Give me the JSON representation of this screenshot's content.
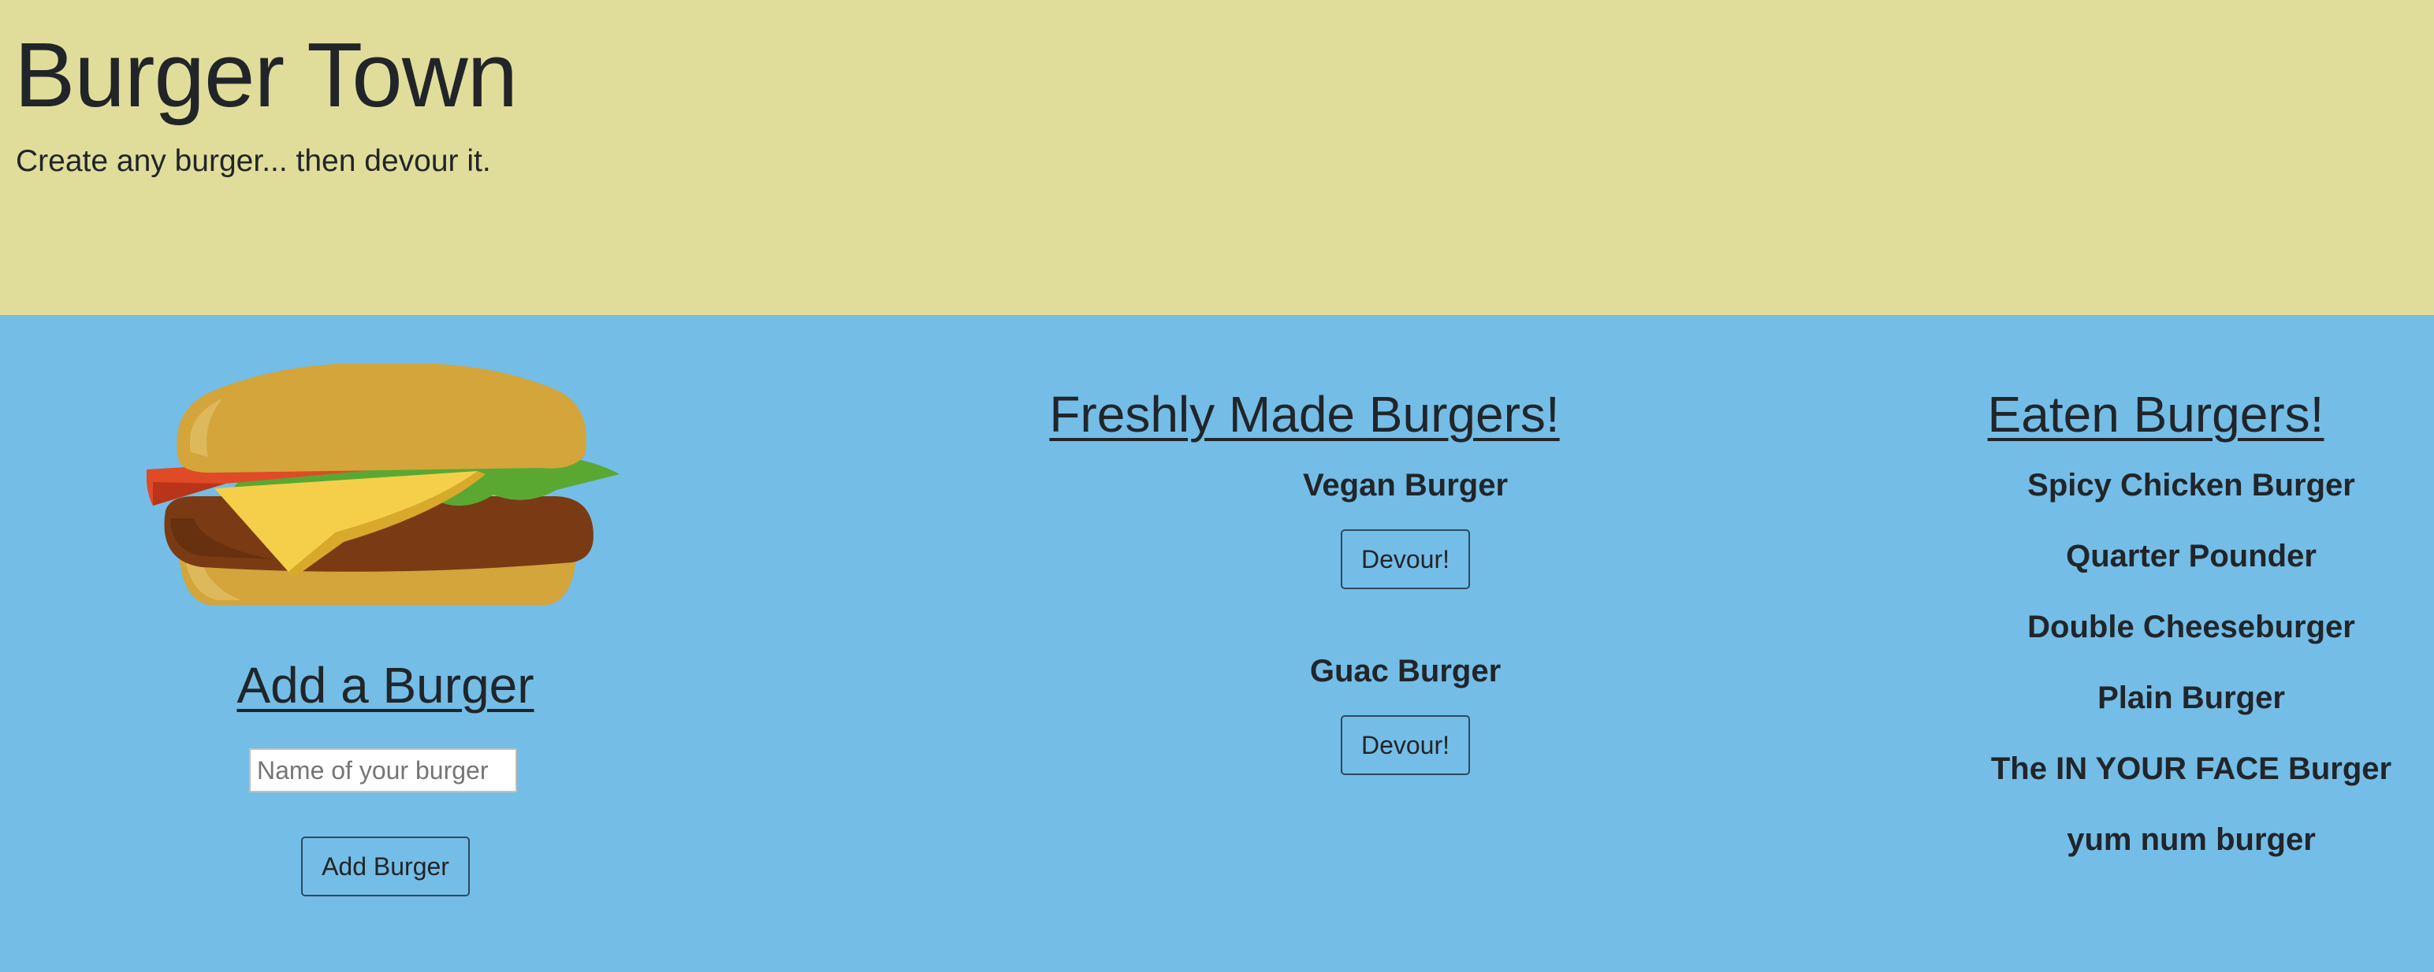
{
  "header": {
    "title": "Burger Town",
    "tagline": "Create any burger... then devour it."
  },
  "add_section": {
    "image_icon": "burger-illustration",
    "heading": "Add a Burger",
    "input_placeholder": "Name of your burger",
    "input_value": "",
    "button_label": "Add Burger"
  },
  "fresh_section": {
    "heading": "Freshly Made Burgers!",
    "burgers": [
      {
        "name": "Vegan Burger",
        "button_label": "Devour!"
      },
      {
        "name": "Guac Burger",
        "button_label": "Devour!"
      }
    ]
  },
  "eaten_section": {
    "heading": "Eaten Burgers!",
    "burgers": [
      "Spicy Chicken Burger",
      "Quarter Pounder",
      "Double Cheeseburger",
      "Plain Burger",
      "The IN YOUR FACE Burger",
      "yum num burger"
    ]
  },
  "colors": {
    "header_bg": "#e0dd9a",
    "main_bg": "#74bde6",
    "text": "#212529"
  }
}
